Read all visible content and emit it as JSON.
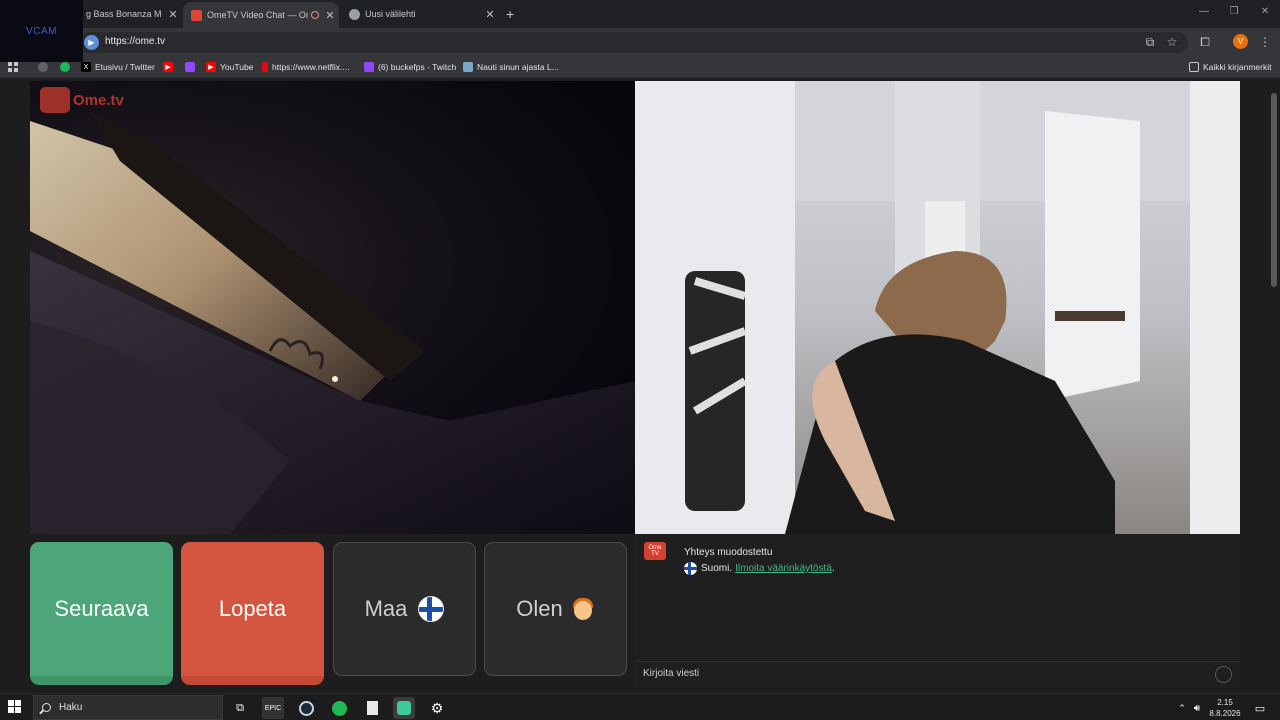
{
  "overlay": {
    "vcam_label": "VCAM"
  },
  "browser": {
    "tabs": [
      {
        "title": "g Bass Bonanza Meg",
        "active": false,
        "favicon_color": "#6c6c6c"
      },
      {
        "title": "OmeTV Video Chat — Ome",
        "active": true,
        "favicon_color": "#e0453a"
      },
      {
        "title": "Uusi välilehti",
        "active": false,
        "favicon_color": "#9aa0a6"
      }
    ],
    "new_tab_symbol": "+",
    "address": "https://ome.tv",
    "profile_initial": "V",
    "bookmarks": [
      {
        "label": "",
        "icon": "globe-icon",
        "color": "#5f6368"
      },
      {
        "label": "",
        "icon": "spotify-icon",
        "color": "#1db954"
      },
      {
        "label": "Etusivu / Twitter",
        "icon": "x-icon",
        "color": "#000000"
      },
      {
        "label": "",
        "icon": "youtube-icon",
        "color": "#ff0000"
      },
      {
        "label": "",
        "icon": "twitch-icon",
        "color": "#9146ff"
      },
      {
        "label": "YouTube",
        "icon": "youtube-icon",
        "color": "#ff0000"
      },
      {
        "label": "https://www.netflix....",
        "icon": "netflix-icon",
        "color": "#e50914"
      },
      {
        "label": "(6) buckefps - Twitch",
        "icon": "twitch-icon",
        "color": "#9146ff"
      },
      {
        "label": "Nauti sinun ajasta L...",
        "icon": "site-icon",
        "color": "#7aa7c7"
      }
    ],
    "all_bookmarks_label": "Kaikki kirjanmerkit"
  },
  "omegle": {
    "logo_text": "Ome.tv",
    "buttons": {
      "next": "Seuraava",
      "stop": "Lopeta",
      "country": "Maa",
      "gender": "Olen"
    },
    "chat": {
      "status": "Yhteys muodostettu",
      "country_text": "Suomi.",
      "report_link": "Ilmoita väärinkäytöstä",
      "input_placeholder": "Kirjoita viesti"
    },
    "colors": {
      "next": "#4ca67a",
      "stop": "#d4553f",
      "link": "#42b883"
    }
  },
  "taskbar": {
    "search_placeholder": "Haku",
    "time": "2.15",
    "date": "8.8.2026"
  }
}
